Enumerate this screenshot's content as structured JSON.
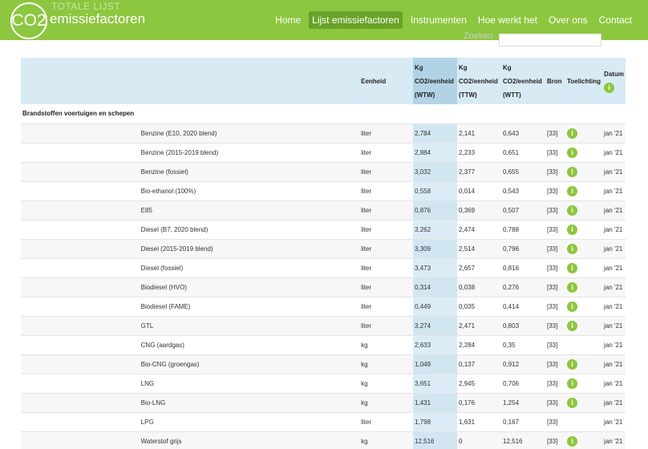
{
  "header": {
    "logo_mark": "CO2",
    "logo_text": "emissiefactoren",
    "ghost_title": "TOTALE LIJST",
    "nav": [
      {
        "label": "Home",
        "active": false
      },
      {
        "label": "Lijst emissiefactoren",
        "active": true
      },
      {
        "label": "Instrumenten",
        "active": false
      },
      {
        "label": "Hoe werkt het",
        "active": false
      },
      {
        "label": "Over ons",
        "active": false
      },
      {
        "label": "Contact",
        "active": false
      }
    ],
    "search_label": "Zoeken",
    "search_value": ""
  },
  "table": {
    "columns": {
      "eenheid": "Eenheid",
      "wtw": [
        "Kg",
        "CO2/eenheid",
        "(WTW)"
      ],
      "ttw": [
        "Kg",
        "CO2/eenheid",
        "(TTW)"
      ],
      "wtt": [
        "Kg",
        "CO2/eenheid",
        "(WTT)"
      ],
      "bron": "Bron",
      "toelichting": "Toelichting",
      "datum": "Datum"
    },
    "group": "Brandstoffen voertuigen en schepen",
    "rows": [
      {
        "name": "Benzine (E10, 2020 blend)",
        "unit": "liter",
        "wtw": "2,784",
        "ttw": "2,141",
        "wtt": "0,643",
        "bron": "[33]",
        "info": true,
        "datum": "jan '21"
      },
      {
        "name": "Benzine (2015-2019 blend)",
        "unit": "liter",
        "wtw": "2,884",
        "ttw": "2,233",
        "wtt": "0,651",
        "bron": "[33]",
        "info": true,
        "datum": "jan '21"
      },
      {
        "name": "Benzine (fossiel)",
        "unit": "liter",
        "wtw": "3,032",
        "ttw": "2,377",
        "wtt": "0,655",
        "bron": "[33]",
        "info": true,
        "datum": "jan '21"
      },
      {
        "name": "Bio-ethanol (100%)",
        "unit": "liter",
        "wtw": "0,558",
        "ttw": "0,014",
        "wtt": "0,543",
        "bron": "[33]",
        "info": true,
        "datum": "jan '21"
      },
      {
        "name": "E85",
        "unit": "liter",
        "wtw": "0,876",
        "ttw": "0,369",
        "wtt": "0,507",
        "bron": "[33]",
        "info": true,
        "datum": "jan '21"
      },
      {
        "name": "Diesel (B7, 2020 blend)",
        "unit": "liter",
        "wtw": "3,262",
        "ttw": "2,474",
        "wtt": "0,788",
        "bron": "[33]",
        "info": true,
        "datum": "jan '21"
      },
      {
        "name": "Diesel (2015-2019 blend)",
        "unit": "liter",
        "wtw": "3,309",
        "ttw": "2,514",
        "wtt": "0,796",
        "bron": "[33]",
        "info": true,
        "datum": "jan '21"
      },
      {
        "name": "Diesel (fossiel)",
        "unit": "liter",
        "wtw": "3,473",
        "ttw": "2,657",
        "wtt": "0,816",
        "bron": "[33]",
        "info": true,
        "datum": "jan '21"
      },
      {
        "name": "Biodiesel (HVO)",
        "unit": "liter",
        "wtw": "0,314",
        "ttw": "0,038",
        "wtt": "0,276",
        "bron": "[33]",
        "info": true,
        "datum": "jan '21"
      },
      {
        "name": "Biodiesel (FAME)",
        "unit": "liter",
        "wtw": "0,449",
        "ttw": "0,035",
        "wtt": "0,414",
        "bron": "[33]",
        "info": true,
        "datum": "jan '21"
      },
      {
        "name": "GTL",
        "unit": "liter",
        "wtw": "3,274",
        "ttw": "2,471",
        "wtt": "0,803",
        "bron": "[33]",
        "info": true,
        "datum": "jan '21"
      },
      {
        "name": "CNG (aardgas)",
        "unit": "kg",
        "wtw": "2,633",
        "ttw": "2,284",
        "wtt": "0,35",
        "bron": "[33]",
        "info": false,
        "datum": "jan '21"
      },
      {
        "name": "Bio-CNG (groengas)",
        "unit": "kg",
        "wtw": "1,049",
        "ttw": "0,137",
        "wtt": "0,912",
        "bron": "[33]",
        "info": true,
        "datum": "jan '21"
      },
      {
        "name": "LNG",
        "unit": "kg",
        "wtw": "3,651",
        "ttw": "2,945",
        "wtt": "0,706",
        "bron": "[33]",
        "info": true,
        "datum": "jan '21"
      },
      {
        "name": "Bio-LNG",
        "unit": "kg",
        "wtw": "1,431",
        "ttw": "0,176",
        "wtt": "1,254",
        "bron": "[33]",
        "info": true,
        "datum": "jan '21"
      },
      {
        "name": "LPG",
        "unit": "liter",
        "wtw": "1,798",
        "ttw": "1,631",
        "wtt": "0,167",
        "bron": "[33]",
        "info": false,
        "datum": "jan '21"
      },
      {
        "name": "Waterstof grijs",
        "unit": "kg",
        "wtw": "12,516",
        "ttw": "0",
        "wtt": "12,516",
        "bron": "[33]",
        "info": true,
        "datum": "jan '21"
      }
    ]
  },
  "info_glyph": "i",
  "colors": {
    "brand_green": "#8dc63f",
    "active_nav": "#6aa22a",
    "header_blue": "#d8ebf5",
    "wtw_highlight": "#b2d3e6"
  }
}
